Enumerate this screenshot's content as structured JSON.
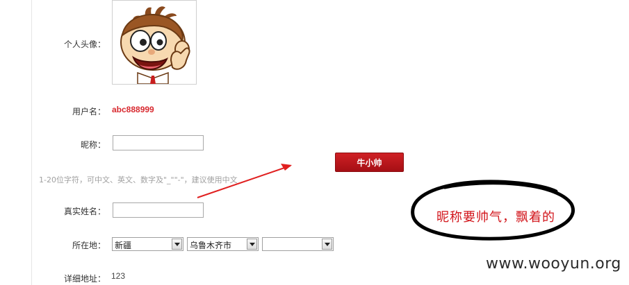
{
  "form": {
    "avatar_label": "个人头像：",
    "username_label": "用户名：",
    "username_value": "abc888999",
    "nickname_label": "昵称：",
    "nickname_value": "",
    "nickname_hint": "1-20位字符，可中文、英文、数字及\"_\"\"-\"，建议使用中文",
    "nickname_button": "牛小帅",
    "realname_label": "真实姓名：",
    "realname_value": "",
    "location_label": "所在地：",
    "province": "新疆",
    "city": "乌鲁木齐市",
    "district": "",
    "address_label": "详细地址：",
    "address_value": "123"
  },
  "annotation": {
    "text": "昵称要帅气，飘着的",
    "color": "#d2151b",
    "arrow_color": "#e02020"
  },
  "watermark": "www.wooyun.org",
  "colors": {
    "username": "#d8292f",
    "button_bg": "#b8151a"
  }
}
